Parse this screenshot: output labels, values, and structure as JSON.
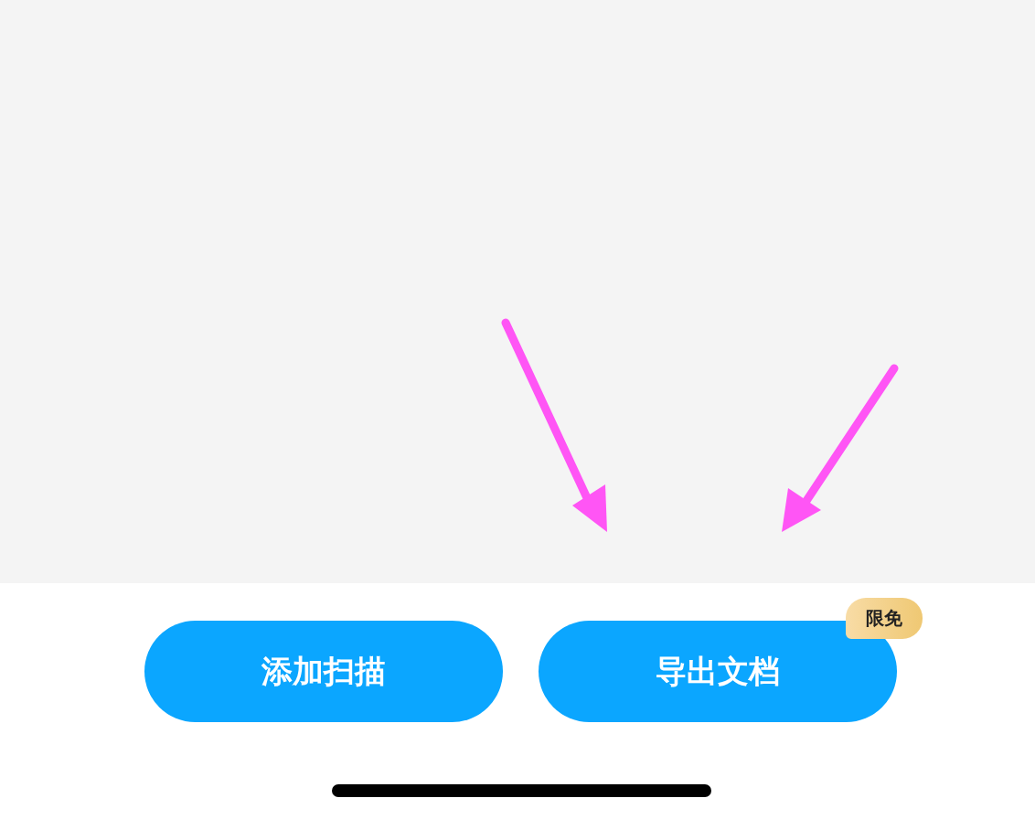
{
  "buttons": [
    {
      "label": "添加扫描"
    },
    {
      "label": "导出文档",
      "badge": "限免"
    }
  ]
}
